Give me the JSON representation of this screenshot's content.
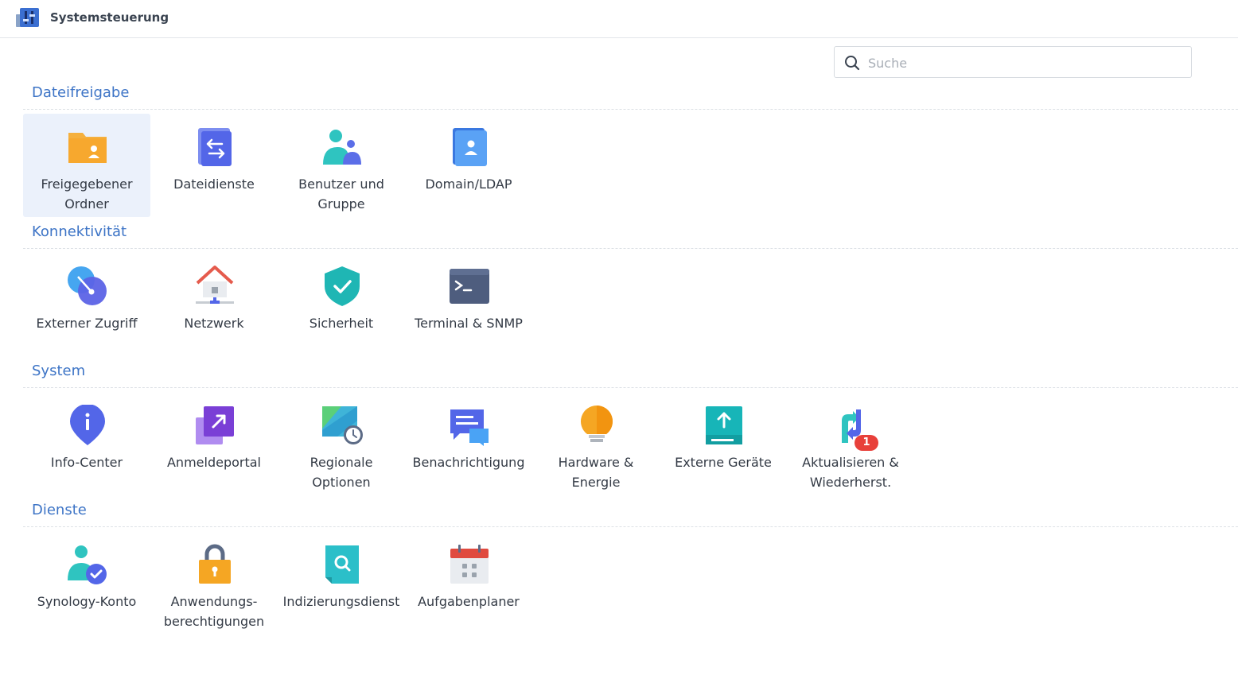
{
  "window": {
    "title": "Systemsteuerung"
  },
  "search": {
    "placeholder": "Suche"
  },
  "sections": {
    "file_sharing": {
      "title": "Dateifreigabe",
      "items": [
        {
          "label": "Freigegebener\nOrdner",
          "icon": "shared-folder-icon"
        },
        {
          "label": "Dateidienste",
          "icon": "file-services-icon"
        },
        {
          "label": "Benutzer und\nGruppe",
          "icon": "user-group-icon"
        },
        {
          "label": "Domain/LDAP",
          "icon": "domain-ldap-icon"
        }
      ]
    },
    "connectivity": {
      "title": "Konnektivität",
      "items": [
        {
          "label": "Externer Zugriff",
          "icon": "external-access-icon"
        },
        {
          "label": "Netzwerk",
          "icon": "network-icon"
        },
        {
          "label": "Sicherheit",
          "icon": "security-shield-icon"
        },
        {
          "label": "Terminal & SNMP",
          "icon": "terminal-icon"
        }
      ]
    },
    "system": {
      "title": "System",
      "items": [
        {
          "label": "Info-Center",
          "icon": "info-center-icon"
        },
        {
          "label": "Anmeldeportal",
          "icon": "login-portal-icon"
        },
        {
          "label": "Regionale\nOptionen",
          "icon": "regional-options-icon"
        },
        {
          "label": "Benachrichtigung",
          "icon": "notification-icon"
        },
        {
          "label": "Hardware &\nEnergie",
          "icon": "hardware-power-icon"
        },
        {
          "label": "Externe Geräte",
          "icon": "external-devices-icon"
        },
        {
          "label": "Aktualisieren &\nWiederherst.",
          "icon": "update-restore-icon",
          "badge": "1"
        }
      ]
    },
    "services": {
      "title": "Dienste",
      "items": [
        {
          "label": "Synology-Konto",
          "icon": "synology-account-icon"
        },
        {
          "label": "Anwendungs-\nberechtigungen",
          "icon": "app-privileges-icon"
        },
        {
          "label": "Indizierungsdienst",
          "icon": "indexing-service-icon"
        },
        {
          "label": "Aufgabenplaner",
          "icon": "task-scheduler-icon"
        }
      ]
    }
  },
  "colors": {
    "section_title": "#3d74c6",
    "selected_tile_bg": "#ebf1fb",
    "badge": "#e8403a"
  }
}
